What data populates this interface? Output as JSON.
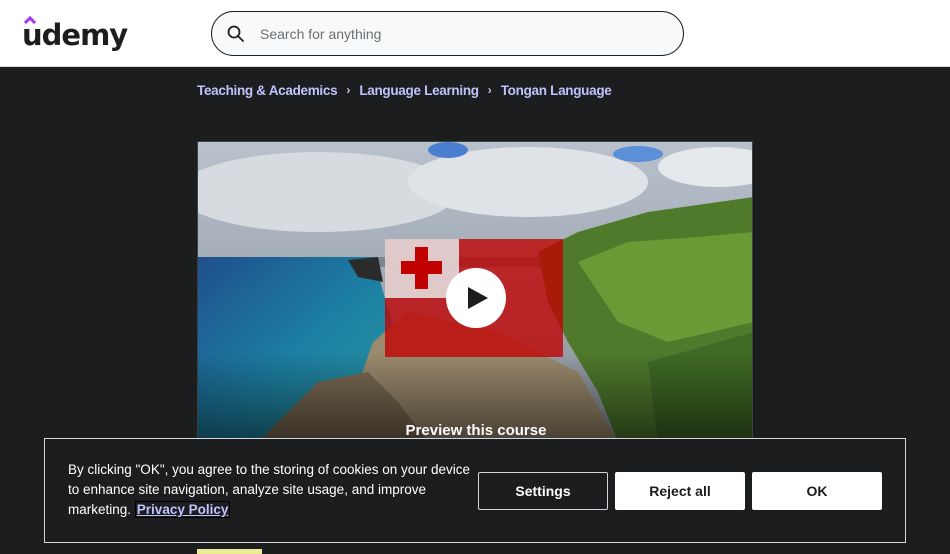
{
  "header": {
    "logo_text": "udemy",
    "search": {
      "placeholder": "Search for anything",
      "value": ""
    }
  },
  "breadcrumb": [
    {
      "label": "Teaching & Academics"
    },
    {
      "label": "Language Learning"
    },
    {
      "label": "Tongan Language"
    }
  ],
  "video": {
    "preview_label": "Preview this course",
    "flag": "Tonga flag",
    "colors": {
      "flag_red": "#c10000",
      "flag_white": "#ffffff"
    }
  },
  "cookie_banner": {
    "message": "By clicking \"OK\", you agree to the storing of cookies on your device to enhance site navigation, analyze site usage, and improve marketing.",
    "privacy_link": "Privacy Policy",
    "buttons": {
      "settings": "Settings",
      "reject": "Reject all",
      "ok": "OK"
    }
  },
  "colors": {
    "brand_purple": "#a435f0",
    "link_lavender": "#c0c4fc",
    "dark_bg": "#1c1d1f"
  }
}
